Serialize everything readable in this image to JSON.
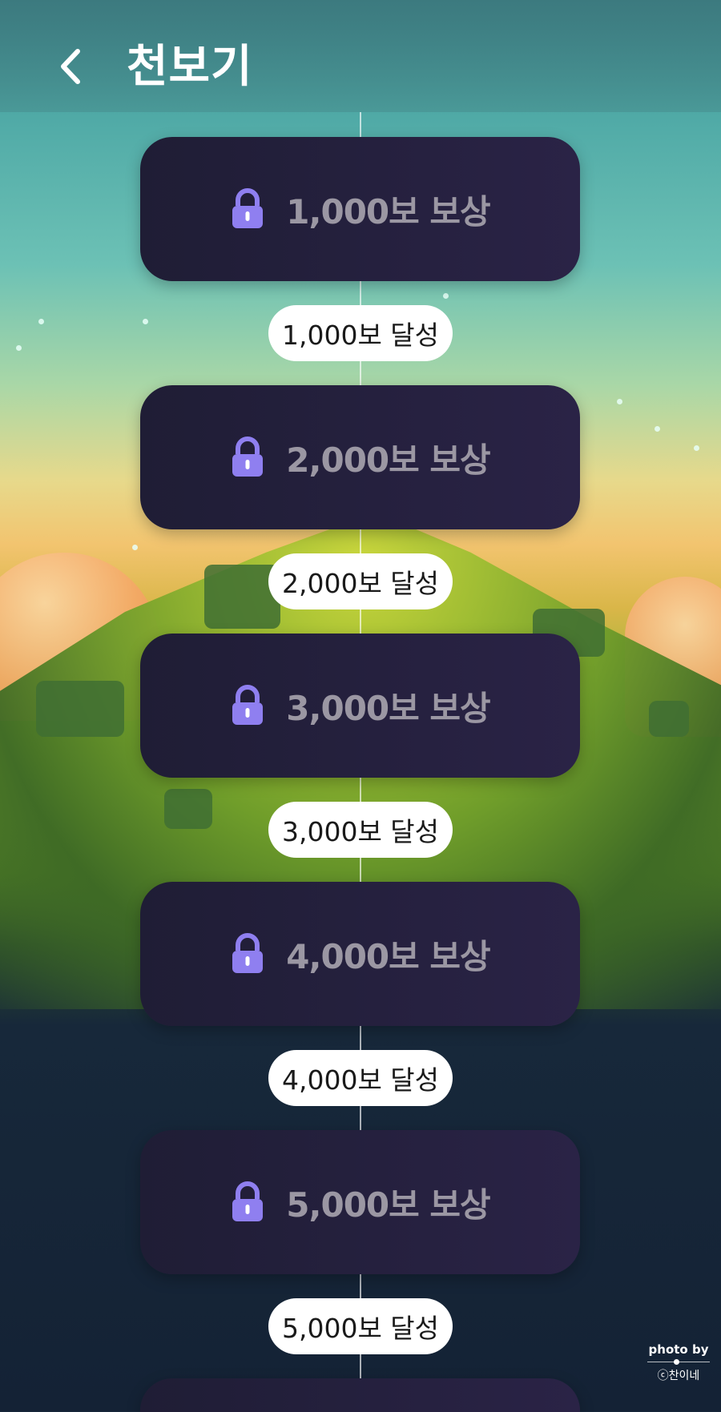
{
  "header": {
    "title": "천보기",
    "back_icon": "chevron-left-icon"
  },
  "rewards": [
    {
      "label": "1,000보 보상",
      "milestone": "1,000보 달성",
      "locked": true
    },
    {
      "label": "2,000보 보상",
      "milestone": "2,000보 달성",
      "locked": true
    },
    {
      "label": "3,000보 보상",
      "milestone": "3,000보 달성",
      "locked": true
    },
    {
      "label": "4,000보 보상",
      "milestone": "4,000보 달성",
      "locked": true
    },
    {
      "label": "5,000보 보상",
      "milestone": "5,000보 달성",
      "locked": true
    }
  ],
  "credit": {
    "by": "photo by",
    "name": "ⓒ찬이네"
  },
  "colors": {
    "card_bg": "#1f1d35",
    "card_text": "#9b97a3",
    "lock": "#8f7ff0",
    "pill_bg": "#ffffff"
  }
}
